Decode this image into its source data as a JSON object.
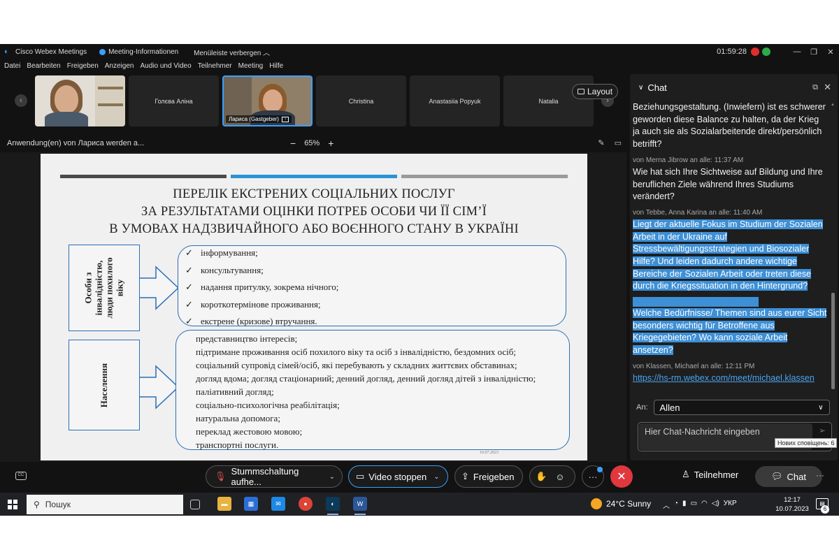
{
  "window": {
    "app_name": "Cisco Webex Meetings",
    "meeting_info": "Meeting-Informationen",
    "hide_menu": "Menüleiste verbergen",
    "timer": "01:59:28",
    "colors": {
      "accent": "#3aa0ff",
      "record": "#e02d2d",
      "signal": "#2eaa4a",
      "end_call": "#e0383e"
    }
  },
  "menu": [
    "Datei",
    "Bearbeiten",
    "Freigeben",
    "Anzeigen",
    "Audio und Video",
    "Teilnehmer",
    "Meeting",
    "Hilfe"
  ],
  "participants": [
    {
      "name": ""
    },
    {
      "name": "Голєва Аліна"
    },
    {
      "name": "Лариса (Gastgeber)"
    },
    {
      "name": "Christina"
    },
    {
      "name": "Anastasiia Popyuk"
    },
    {
      "name": "Natalia"
    }
  ],
  "layout_button": "Layout",
  "share_bar": {
    "label": "Anwendung(en) von Лариса werden a...",
    "zoom_minus": "−",
    "zoom": "65%",
    "zoom_plus": "+"
  },
  "slide": {
    "title_lines": [
      "ПЕРЕЛІК ЕКСТРЕНИХ СОЦІАЛЬНИХ ПОСЛУГ",
      "ЗА РЕЗУЛЬТАТАМИ ОЦІНКИ ПОТРЕБ ОСОБИ ЧИ ЇЇ СІМ’Ї",
      "В УМОВАХ НАДЗВИЧАЙНОГО АБО ВОЄННОГО СТАНУ В УКРАЇНІ"
    ],
    "group1_label": "Особи з\nінвалідністю,\nлюди похилого\nвіку",
    "group1_items": [
      "інформування;",
      "консультування;",
      "надання притулку, зокрема нічного;",
      "короткотермінове проживання;",
      "екстрене (кризове) втручання."
    ],
    "group2_label": "Населення",
    "group2_items": [
      "представництво інтересів;",
      "підтримане проживання осіб похилого віку та осіб з інвалідністю, бездомних осіб;",
      "соціальний супровід сімей/осіб, які перебувають у складних життєвих обставинах;",
      "догляд вдома; догляд стаціонарний; денний догляд, денний догляд дітей з інвалідністю;",
      "паліативний догляд;",
      "соціально-психологічна реабілітація;",
      "натуральна допомога;",
      "переклад жестовою мовою;",
      "транспортні послуги."
    ],
    "footer": "10.07.2023",
    "colors": {
      "bar1": "#4a4a4a",
      "bar2": "#2a93d5",
      "bar3": "#9a9a9a",
      "box_border": "#2a6fb5"
    }
  },
  "controls": {
    "mute": "Stummschaltung aufhe...",
    "video": "Video stoppen",
    "share": "Freigeben",
    "participants": "Teilnehmer",
    "chat": "Chat",
    "tooltip": "Нових сповіщень: 6"
  },
  "chat": {
    "title": "Chat",
    "messages": [
      {
        "sender": "",
        "text": "Beziehungsgestaltung. (Inwiefern) ist es schwerer geworden diese Balance zu halten, da der Krieg ja auch sie als Sozialarbeitende direkt/persönlich betrifft?",
        "selected": false
      },
      {
        "sender": "von Merna Jibrow an alle:   11:37 AM",
        "text": "Wie hat sich Ihre Sichtweise auf Bildung und Ihre beruflichen Ziele während Ihres Studiums verändert?",
        "selected": false
      },
      {
        "sender": "von Tebbe, Anna Karina an alle:   11:40 AM",
        "text": "Liegt der aktuelle Fokus im Studium der Sozialen Arbeit in der Ukraine auf Stressbewältigungsstrategien und Biosozialer Hilfe? Und leiden dadurch andere wichtige Bereiche der Sozialen Arbeit oder treten diese durch die Kriegssituation in den Hintergrund?",
        "selected": true
      },
      {
        "sender": "von Hannah Fuchs an alle:   11:40 AM",
        "text": "Welche Bedürfnisse/ Themen  sind aus eurer Sicht besonders wichtig für Betroffene aus Kriegegebieten? Wo kann soziale Arbeit ansetzen?",
        "selected": true
      },
      {
        "sender": "von Klassen, Michael an alle:   12:11 PM",
        "text": "https://hs-rm.webex.com/meet/michael.klassen",
        "selected": false,
        "link": true
      }
    ],
    "to_label": "An:",
    "to_value": "Allen",
    "input_placeholder": "Hier Chat-Nachricht eingeben"
  },
  "taskbar": {
    "search": "Пошук",
    "weather": "24°C  Sunny",
    "lang": "УКР",
    "time": "12:17",
    "date": "10.07.2023",
    "notifications": "6"
  }
}
